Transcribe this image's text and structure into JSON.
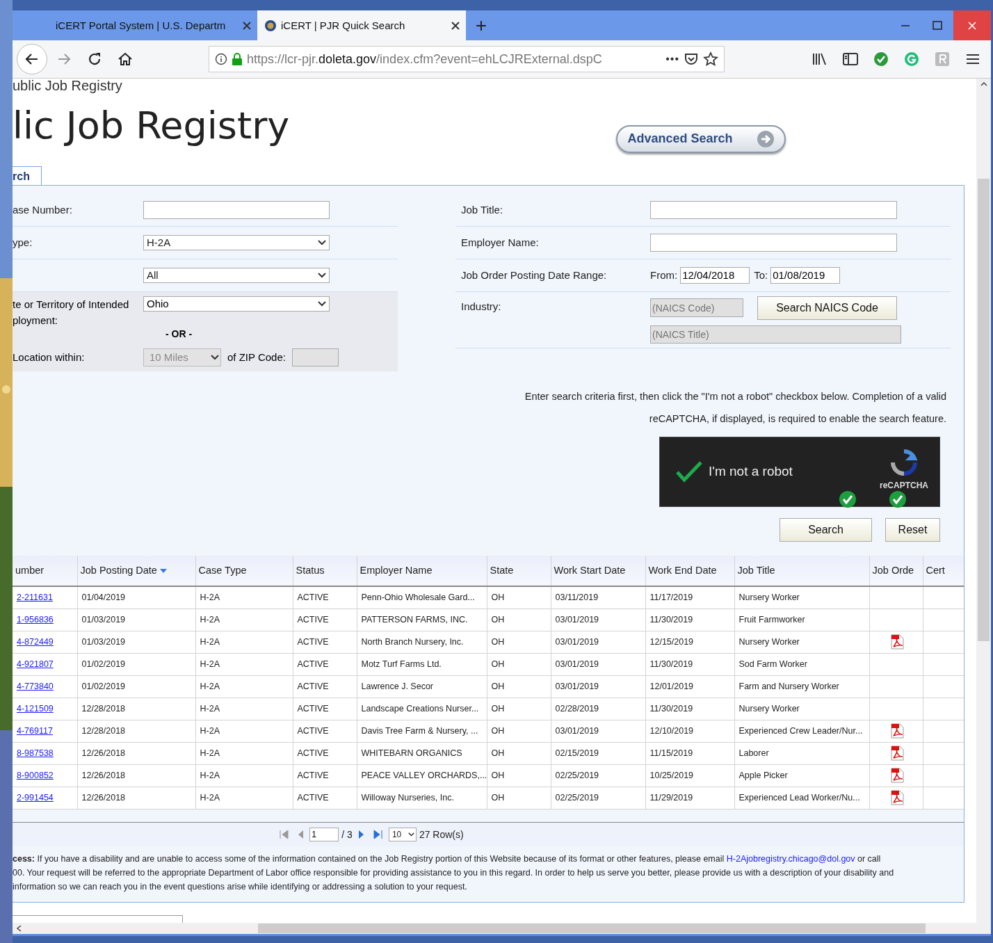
{
  "browser": {
    "tabs": [
      {
        "title": "iCERT Portal System | U.S. Departm",
        "selected": false,
        "favicon": false
      },
      {
        "title": "iCERT | PJR Quick Search",
        "selected": true,
        "favicon": true
      }
    ],
    "new_tab": "+",
    "url": "https://lcr-pjr.**doleta.gov**/index.cfm?event=ehLCJRExternal.dspC",
    "page_actions": "•••"
  },
  "page": {
    "breadcrumb": "ublic Job Registry",
    "heading": "lic Job Registry",
    "advanced_button": "Advanced Search",
    "tab": "rch",
    "left_fields": [
      {
        "label": "ase Number:",
        "kind": "text"
      },
      {
        "label": "ype:",
        "kind": "select",
        "value": "H-2A"
      },
      {
        "kind": "select",
        "value": "All"
      }
    ],
    "location": {
      "state_label": "te or Territory of Intended ployment:",
      "state_value": "Ohio",
      "or_text": "- OR -",
      "within_label": "Location within:",
      "miles": "10 Miles",
      "zip_label": "of ZIP Code:"
    },
    "right_fields": [
      {
        "label": "Job Title:",
        "kind": "text"
      },
      {
        "label": "Employer Name:",
        "kind": "text"
      }
    ],
    "date_range": {
      "label": "Job Order Posting Date Range:",
      "from_label": "From:",
      "from": "12/04/2018",
      "to_label": "To:",
      "to": "01/08/2019"
    },
    "industry": {
      "label": "Industry:",
      "code_placeholder": "(NAICS Code)",
      "button": "Search NAICS Code",
      "title_placeholder": "(NAICS Title)"
    },
    "instructions": "Enter search criteria first, then click the \"I'm not a robot\" checkbox below. Completion of a valid reCAPTCHA, if displayed, is required to enable the search feature.",
    "captcha": {
      "label": "I'm not a robot",
      "checked": true,
      "brand": "reCAPTCHA"
    },
    "buttons": [
      "Search",
      "Reset"
    ],
    "table": {
      "columns": [
        {
          "label": "umber",
          "sorted": false
        },
        {
          "label": "Job Posting Date",
          "sorted": true
        },
        {
          "label": "Case Type",
          "sorted": false
        },
        {
          "label": "Status",
          "sorted": false
        },
        {
          "label": "Employer Name",
          "sorted": false
        },
        {
          "label": "State",
          "sorted": false
        },
        {
          "label": "Work Start Date",
          "sorted": false
        },
        {
          "label": "Work End Date",
          "sorted": false
        },
        {
          "label": "Job Title",
          "sorted": false
        },
        {
          "label": "Job Orde",
          "sorted": false
        },
        {
          "label": "Cert",
          "sorted": false
        }
      ],
      "rows": [
        {
          "case": "2-211631",
          "posted": "01/04/2019",
          "type": "H-2A",
          "status": "ACTIVE",
          "employer": "Penn-Ohio Wholesale Gard...",
          "state": "OH",
          "start": "03/11/2019",
          "end": "11/17/2019",
          "title": "Nursery Worker",
          "job_order_pdf": false
        },
        {
          "case": "1-956836",
          "posted": "01/03/2019",
          "type": "H-2A",
          "status": "ACTIVE",
          "employer": "PATTERSON FARMS, INC.",
          "state": "OH",
          "start": "03/01/2019",
          "end": "11/30/2019",
          "title": "Fruit Farmworker",
          "job_order_pdf": false
        },
        {
          "case": "4-872449",
          "posted": "01/03/2019",
          "type": "H-2A",
          "status": "ACTIVE",
          "employer": "North Branch Nursery, Inc.",
          "state": "OH",
          "start": "03/01/2019",
          "end": "12/15/2019",
          "title": "Nursery Worker",
          "job_order_pdf": true
        },
        {
          "case": "4-921807",
          "posted": "01/02/2019",
          "type": "H-2A",
          "status": "ACTIVE",
          "employer": "Motz Turf Farms Ltd.",
          "state": "OH",
          "start": "03/01/2019",
          "end": "11/30/2019",
          "title": "Sod Farm Worker",
          "job_order_pdf": false
        },
        {
          "case": "4-773840",
          "posted": "01/02/2019",
          "type": "H-2A",
          "status": "ACTIVE",
          "employer": "Lawrence J. Secor",
          "state": "OH",
          "start": "03/01/2019",
          "end": "12/01/2019",
          "title": "Farm and Nursery Worker",
          "job_order_pdf": false
        },
        {
          "case": "4-121509",
          "posted": "12/28/2018",
          "type": "H-2A",
          "status": "ACTIVE",
          "employer": "Landscape Creations Nurser...",
          "state": "OH",
          "start": "02/28/2019",
          "end": "11/30/2019",
          "title": "Nursery Worker",
          "job_order_pdf": false
        },
        {
          "case": "4-769117",
          "posted": "12/28/2018",
          "type": "H-2A",
          "status": "ACTIVE",
          "employer": "Davis Tree Farm & Nursery, ...",
          "state": "OH",
          "start": "03/01/2019",
          "end": "12/10/2019",
          "title": "Experienced Crew Leader/Nur...",
          "job_order_pdf": true
        },
        {
          "case": "8-987538",
          "posted": "12/26/2018",
          "type": "H-2A",
          "status": "ACTIVE",
          "employer": "WHITEBARN ORGANICS",
          "state": "OH",
          "start": "02/15/2019",
          "end": "11/15/2019",
          "title": "Laborer",
          "job_order_pdf": true
        },
        {
          "case": "8-900852",
          "posted": "12/26/2018",
          "type": "H-2A",
          "status": "ACTIVE",
          "employer": "PEACE VALLEY ORCHARDS,...",
          "state": "OH",
          "start": "02/25/2019",
          "end": "10/25/2019",
          "title": "Apple Picker",
          "job_order_pdf": true
        },
        {
          "case": "2-991454",
          "posted": "12/26/2018",
          "type": "H-2A",
          "status": "ACTIVE",
          "employer": "Willoway Nurseries, Inc.",
          "state": "OH",
          "start": "02/25/2019",
          "end": "11/29/2019",
          "title": "Experienced Lead Worker/Nu...",
          "job_order_pdf": true
        }
      ]
    },
    "pager": {
      "page": "1",
      "of": "/ 3",
      "size": "10",
      "rows": "27 Row(s)"
    },
    "notice": {
      "before": "**cess:** If you have a disability and are unable to access some of the information contained on the Job Registry portion of this Website because of its format or other features, please email",
      "link": "H-2Ajobregistry.chicago@dol.gov",
      "after": [
        "or call",
        "00. Your request will be referred to the appropriate Department of Labor office responsible for providing assistance to you in this regard. In order to help us serve you better, please provide us with a description of your disability and",
        "information so we can reach you in the event questions arise while identifying or addressing a solution to your request."
      ]
    }
  }
}
